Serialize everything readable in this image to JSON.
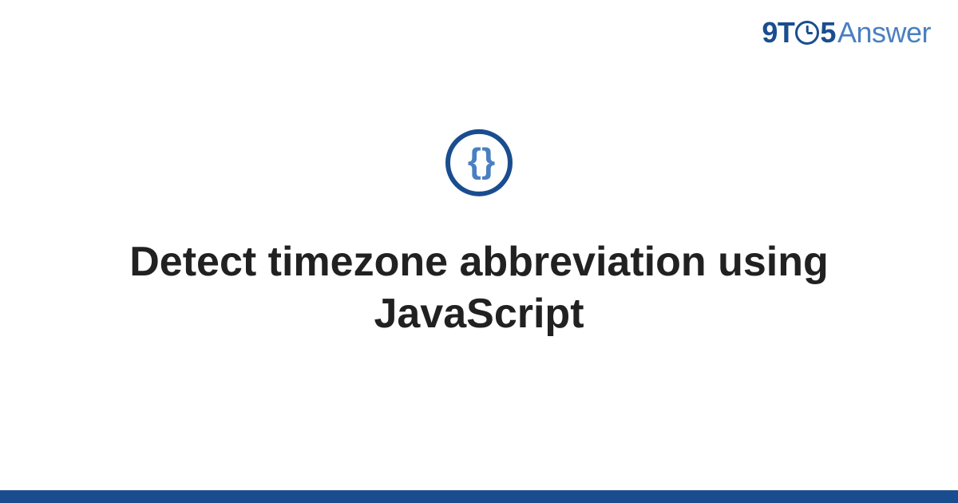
{
  "logo": {
    "part1": "9T",
    "part2": "5",
    "part3": "Answer"
  },
  "icon": {
    "braces": "{ }",
    "name": "code-braces-icon"
  },
  "title": "Detect timezone abbreviation using JavaScript",
  "colors": {
    "primary": "#1a4d8f",
    "secondary": "#4a7fc1",
    "text": "#212121"
  }
}
